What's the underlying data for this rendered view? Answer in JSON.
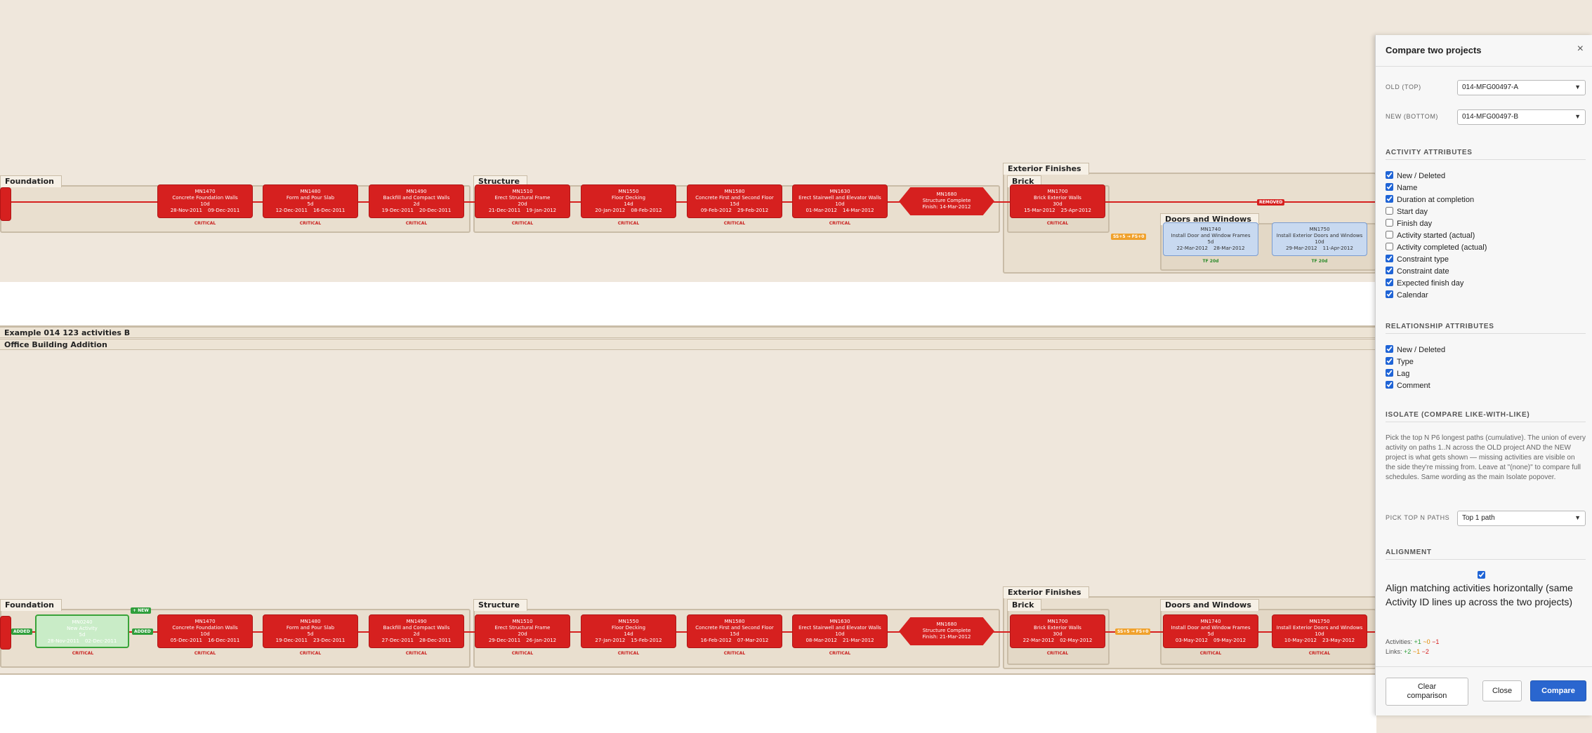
{
  "projectA": {
    "groups": {
      "foundation": "Foundation",
      "structure": "Structure",
      "exterior": "Exterior Finishes",
      "brick": "Brick",
      "doors": "Doors and Windows"
    },
    "acts": [
      {
        "id": "MN1470",
        "name": "Concrete Foundation Walls",
        "dur": "10d",
        "start": "28-Nov-2011",
        "finish": "09-Dec-2011",
        "crit": "CRITICAL"
      },
      {
        "id": "MN1480",
        "name": "Form and Pour Slab",
        "dur": "5d",
        "start": "12-Dec-2011",
        "finish": "16-Dec-2011",
        "crit": "CRITICAL"
      },
      {
        "id": "MN1490",
        "name": "Backfill and Compact Walls",
        "dur": "2d",
        "start": "19-Dec-2011",
        "finish": "20-Dec-2011",
        "crit": "CRITICAL"
      },
      {
        "id": "MN1510",
        "name": "Erect Structural Frame",
        "dur": "20d",
        "start": "21-Dec-2011",
        "finish": "19-Jan-2012",
        "crit": "CRITICAL"
      },
      {
        "id": "MN1550",
        "name": "Floor Decking",
        "dur": "14d",
        "start": "20-Jan-2012",
        "finish": "08-Feb-2012",
        "crit": "CRITICAL"
      },
      {
        "id": "MN1580",
        "name": "Concrete First and Second Floor",
        "dur": "15d",
        "start": "09-Feb-2012",
        "finish": "29-Feb-2012",
        "crit": "CRITICAL"
      },
      {
        "id": "MN1630",
        "name": "Erect Stairwell and Elevator Walls",
        "dur": "10d",
        "start": "01-Mar-2012",
        "finish": "14-Mar-2012",
        "crit": "CRITICAL"
      },
      {
        "id": "MN1700",
        "name": "Brick Exterior Walls",
        "dur": "30d",
        "start": "15-Mar-2012",
        "finish": "25-Apr-2012",
        "crit": "CRITICAL"
      },
      {
        "id": "MN1740",
        "name": "Install Door and Window Frames",
        "dur": "5d",
        "start": "22-Mar-2012",
        "finish": "28-Mar-2012",
        "crit": "TF 20d"
      },
      {
        "id": "MN1750",
        "name": "Install Exterior Doors and Windows",
        "dur": "10d",
        "start": "29-Mar-2012",
        "finish": "11-Apr-2012",
        "crit": "TF 20d"
      }
    ],
    "milestone": {
      "id": "MN1680",
      "name": "Structure Complete",
      "finish": "Finish: 14-Mar-2012"
    },
    "removed_badge": "REMOVED",
    "link_badge": "SS+5 → FS+0"
  },
  "projectB": {
    "label1": "Example 014 123 activities B",
    "label2": "Office Building Addition",
    "groups": {
      "foundation": "Foundation",
      "structure": "Structure",
      "exterior": "Exterior Finishes",
      "brick": "Brick",
      "doors": "Doors and Windows"
    },
    "newAct": {
      "id": "MN0240",
      "name": "New Activity",
      "dur": "5d",
      "start": "28-Nov-2011",
      "finish": "02-Dec-2011",
      "crit": "CRITICAL"
    },
    "new_badge": "+ NEW",
    "added_badge": "ADDED",
    "acts": [
      {
        "id": "MN1470",
        "name": "Concrete Foundation Walls",
        "dur": "10d",
        "start": "05-Dec-2011",
        "finish": "16-Dec-2011",
        "crit": "CRITICAL"
      },
      {
        "id": "MN1480",
        "name": "Form and Pour Slab",
        "dur": "5d",
        "start": "19-Dec-2011",
        "finish": "23-Dec-2011",
        "crit": "CRITICAL"
      },
      {
        "id": "MN1490",
        "name": "Backfill and Compact Walls",
        "dur": "2d",
        "start": "27-Dec-2011",
        "finish": "28-Dec-2011",
        "crit": "CRITICAL"
      },
      {
        "id": "MN1510",
        "name": "Erect Structural Frame",
        "dur": "20d",
        "start": "29-Dec-2011",
        "finish": "26-Jan-2012",
        "crit": "CRITICAL"
      },
      {
        "id": "MN1550",
        "name": "Floor Decking",
        "dur": "14d",
        "start": "27-Jan-2012",
        "finish": "15-Feb-2012",
        "crit": "CRITICAL"
      },
      {
        "id": "MN1580",
        "name": "Concrete First and Second Floor",
        "dur": "15d",
        "start": "16-Feb-2012",
        "finish": "07-Mar-2012",
        "crit": "CRITICAL"
      },
      {
        "id": "MN1630",
        "name": "Erect Stairwell and Elevator Walls",
        "dur": "10d",
        "start": "08-Mar-2012",
        "finish": "21-Mar-2012",
        "crit": "CRITICAL"
      },
      {
        "id": "MN1700",
        "name": "Brick Exterior Walls",
        "dur": "30d",
        "start": "22-Mar-2012",
        "finish": "02-May-2012",
        "crit": "CRITICAL"
      },
      {
        "id": "MN1740",
        "name": "Install Door and Window Frames",
        "dur": "5d",
        "start": "03-May-2012",
        "finish": "09-May-2012",
        "crit": "CRITICAL"
      },
      {
        "id": "MN1750",
        "name": "Install Exterior Doors and Windows",
        "dur": "10d",
        "start": "10-May-2012",
        "finish": "23-May-2012",
        "crit": "CRITICAL"
      }
    ],
    "milestone": {
      "id": "MN1680",
      "name": "Structure Complete",
      "finish": "Finish: 21-Mar-2012"
    },
    "link_badge": "SS+5 → FS+0"
  },
  "panel": {
    "title": "Compare two projects",
    "close_icon": "×",
    "old_label": "OLD (TOP)",
    "old_value": "014-MFG00497-A",
    "new_label": "NEW (BOTTOM)",
    "new_value": "014-MFG00497-B",
    "activity_head": "ACTIVITY ATTRIBUTES",
    "activity_attrs": [
      {
        "label": "New / Deleted",
        "checked": true
      },
      {
        "label": "Name",
        "checked": true
      },
      {
        "label": "Duration at completion",
        "checked": true
      },
      {
        "label": "Start day",
        "checked": false
      },
      {
        "label": "Finish day",
        "checked": false
      },
      {
        "label": "Activity started (actual)",
        "checked": false
      },
      {
        "label": "Activity completed (actual)",
        "checked": false
      },
      {
        "label": "Constraint type",
        "checked": true
      },
      {
        "label": "Constraint date",
        "checked": true
      },
      {
        "label": "Expected finish day",
        "checked": true
      },
      {
        "label": "Calendar",
        "checked": true
      }
    ],
    "relationship_head": "RELATIONSHIP ATTRIBUTES",
    "relationship_attrs": [
      {
        "label": "New / Deleted",
        "checked": true
      },
      {
        "label": "Type",
        "checked": true
      },
      {
        "label": "Lag",
        "checked": true
      },
      {
        "label": "Comment",
        "checked": true
      }
    ],
    "isolate_head": "ISOLATE (COMPARE LIKE-WITH-LIKE)",
    "isolate_text": "Pick the top N P6 longest paths (cumulative). The union of every activity on paths 1..N across the OLD project AND the NEW project is what gets shown — missing activities are visible on the side they're missing from. Leave at \"(none)\" to compare full schedules. Same wording as the main Isolate popover.",
    "topn_label": "PICK TOP N PATHS",
    "topn_value": "Top 1 path",
    "alignment_head": "ALIGNMENT",
    "align_text": "Align matching activities horizontally (same Activity ID lines up across the two projects)",
    "activities_label": "Activities:",
    "activities_added": "+1",
    "activities_changed": "~0",
    "activities_removed": "−1",
    "links_label": "Links:",
    "links_added": "+2",
    "links_changed": "~1",
    "links_removed": "−2",
    "clear_btn": "Clear comparison",
    "close_btn": "Close",
    "compare_btn": "Compare"
  }
}
